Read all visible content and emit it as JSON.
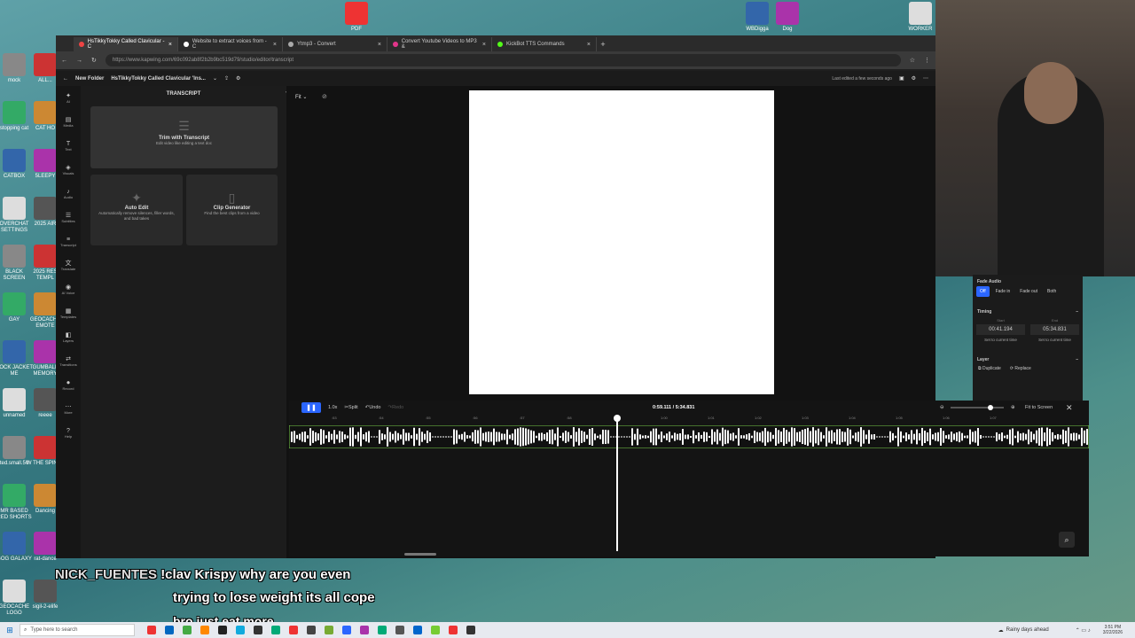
{
  "colors": {
    "accent": "#2b66ff",
    "waveform": "#ffffff",
    "timeline_border": "#7bd24a"
  },
  "desktop_icons_left": [
    {
      "label": "mock"
    },
    {
      "label": "ALL..."
    },
    {
      "label": "stopping cat"
    },
    {
      "label": "CAT HO"
    },
    {
      "label": "CATBOX"
    },
    {
      "label": "5LEEPY"
    },
    {
      "label": "OVERCHAT SETTINGS"
    },
    {
      "label": "2025 AIR"
    },
    {
      "label": "BLACK SCREEN"
    },
    {
      "label": "2025 RES TEMPL"
    },
    {
      "label": "GAY"
    },
    {
      "label": "GEOCACHE EMOTE"
    },
    {
      "label": "ROCK JACKET ME"
    },
    {
      "label": "GUMBALL MEMORY"
    },
    {
      "label": "unnamed"
    },
    {
      "label": "reeee"
    },
    {
      "label": "ted.small.50"
    },
    {
      "label": "W THE SPIN W"
    },
    {
      "label": "MR BASED RED SHORTS"
    },
    {
      "label": "Dancing"
    },
    {
      "label": "GOG GALAXY"
    },
    {
      "label": "rat-dance"
    },
    {
      "label": "GEOCACHE LOGO"
    },
    {
      "label": "sigil-2-elife"
    }
  ],
  "desktop_icons_top": [
    {
      "label": "PDF"
    },
    {
      "label": "WBDigga"
    },
    {
      "label": "Dog"
    },
    {
      "label": "WORKER"
    }
  ],
  "browser": {
    "tabs": [
      {
        "label": "HsTikkyTokky Called Clavicular - C"
      },
      {
        "label": "Website to extract voices from - C"
      },
      {
        "label": "Ytmp3 - Convert"
      },
      {
        "label": "Convert Youtube Videos to MP3 &"
      },
      {
        "label": "KickBot TTS Commands"
      }
    ],
    "url": "https://www.kapwing.com/69c092ab8f2b2b9bc519d79/studio/editor/transcript"
  },
  "app": {
    "folder": "New Folder",
    "project": "HsTikkyTokky Called Clavicular 'Ins...",
    "last_edited": "Last edited a few seconds ago"
  },
  "rail": [
    {
      "label": "AI",
      "icon": "sparkle-icon"
    },
    {
      "label": "Media",
      "icon": "media-icon"
    },
    {
      "label": "Text",
      "icon": "text-icon"
    },
    {
      "label": "Visuals",
      "icon": "visuals-icon"
    },
    {
      "label": "Audio",
      "icon": "audio-icon"
    },
    {
      "label": "Subtitles",
      "icon": "subtitles-icon"
    },
    {
      "label": "Transcript",
      "icon": "transcript-icon"
    },
    {
      "label": "Translate",
      "icon": "translate-icon"
    },
    {
      "label": "AI Voice",
      "icon": "voice-icon"
    },
    {
      "label": "Templates",
      "icon": "templates-icon"
    },
    {
      "label": "Layers",
      "icon": "layers-icon"
    },
    {
      "label": "Transitions",
      "icon": "transitions-icon"
    },
    {
      "label": "Record",
      "icon": "record-icon"
    },
    {
      "label": "More",
      "icon": "more-icon"
    },
    {
      "label": "Help",
      "icon": "help-icon"
    }
  ],
  "panel": {
    "title": "TRANSCRIPT",
    "trim": {
      "title": "Trim with Transcript",
      "subtitle": "Edit video like editing a text doc"
    },
    "auto_edit": {
      "title": "Auto Edit",
      "subtitle": "Automatically remove silences, filler words, and bad takes"
    },
    "clip_gen": {
      "title": "Clip Generator",
      "subtitle": "Find the best clips from a video"
    }
  },
  "stage": {
    "fit": "Fit"
  },
  "side_panel": {
    "fade_title": "Fade Audio",
    "fade_options": [
      "Off",
      "Fade in",
      "Fade out",
      "Both"
    ],
    "timing_title": "Timing",
    "start_label": "Start",
    "end_label": "End",
    "start": "00:41.194",
    "end": "05:34.831",
    "set_current": "Set to current time",
    "layer_title": "Layer",
    "duplicate": "Duplicate",
    "replace": "Replace"
  },
  "timeline": {
    "speed": "1.0x",
    "split": "Split",
    "undo": "Undo",
    "redo": "Redo",
    "time": "0:59.111 / 5:34.831",
    "fit_screen": "Fit to Screen",
    "ticks": [
      ":53",
      ":54",
      ":55",
      ":56",
      ":57",
      ":58",
      ":59",
      "1:00",
      "1:01",
      "1:02",
      "1:03",
      "1:04",
      "1:05",
      "1:06",
      "1:07"
    ]
  },
  "chat": {
    "user": "NICK_FUENTES",
    "line1": "!clav Krispy why are you even",
    "line2": "trying to lose weight its all cope",
    "line3": "bro just eat more"
  },
  "taskbar": {
    "search": "Type here to search",
    "weather": "Rainy days ahead",
    "time": "3:51 PM",
    "date": "3/22/2026"
  }
}
